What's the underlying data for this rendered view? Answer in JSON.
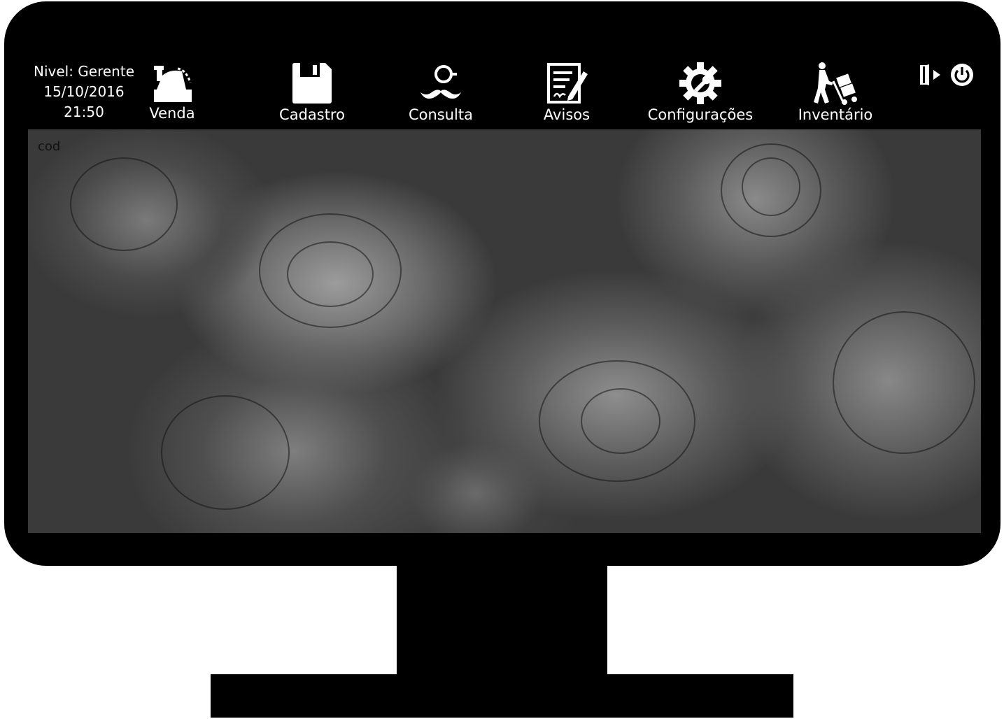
{
  "status": {
    "level": "Nivel: Gerente",
    "date": "15/10/2016",
    "time": "21:50"
  },
  "nav": {
    "venda": "Venda",
    "cadastro": "Cadastro",
    "consulta": "Consulta",
    "avisos": "Avisos",
    "configuracoes": "Configurações",
    "inventario": "Inventário"
  },
  "icons": {
    "venda": "cash-register-icon",
    "cadastro": "floppy-disk-icon",
    "consulta": "disguise-mustache-icon",
    "avisos": "notepad-pen-icon",
    "configuracoes": "gear-wrench-icon",
    "inventario": "hand-truck-icon",
    "logout": "exit-door-icon",
    "power": "power-icon"
  },
  "screen": {
    "field_label": "cod"
  },
  "colors": {
    "bezel": "#000000",
    "text": "#ffffff"
  }
}
